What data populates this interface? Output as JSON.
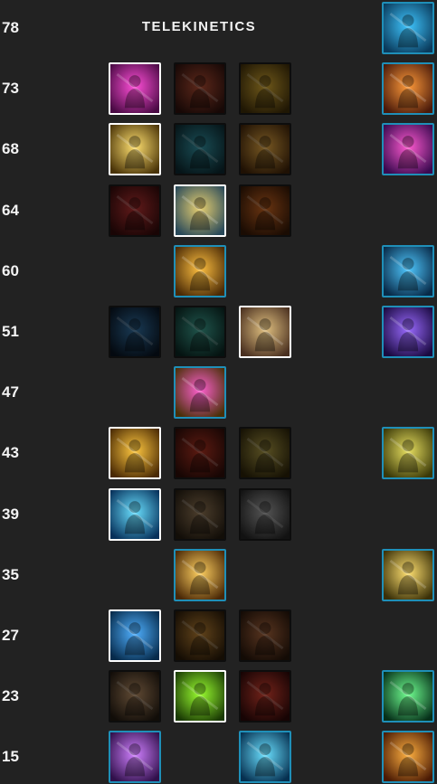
{
  "tree": {
    "title": "TELEKINETICS"
  },
  "rows": [
    {
      "level": "78",
      "slots": [
        {
          "col": 3,
          "state": "available",
          "icon": "telekinetic-hand-icon",
          "colors": [
            "#3fc6ff",
            "#0a3b5c"
          ]
        }
      ]
    },
    {
      "level": "73",
      "slots": [
        {
          "col": 0,
          "state": "selected",
          "icon": "pink-dash-icon",
          "colors": [
            "#ff4fd8",
            "#4a0a44"
          ]
        },
        {
          "col": 1,
          "state": "locked",
          "icon": "red-spin-icon",
          "colors": [
            "#a84830",
            "#2a100c"
          ]
        },
        {
          "col": 2,
          "state": "locked",
          "icon": "gold-figure-icon",
          "colors": [
            "#c9a030",
            "#3a2a08"
          ]
        },
        {
          "col": 3,
          "state": "available",
          "icon": "orange-blast-icon",
          "colors": [
            "#ff9a3a",
            "#4a1a0a"
          ]
        }
      ]
    },
    {
      "level": "68",
      "slots": [
        {
          "col": 0,
          "state": "selected",
          "icon": "golden-beam-icon",
          "colors": [
            "#ffe070",
            "#4a3408"
          ]
        },
        {
          "col": 1,
          "state": "locked",
          "icon": "teal-figure-icon",
          "colors": [
            "#2f8b9a",
            "#0c262c"
          ]
        },
        {
          "col": 2,
          "state": "locked",
          "icon": "golden-pyramid-icon",
          "colors": [
            "#d9a040",
            "#3a2008"
          ]
        },
        {
          "col": 3,
          "state": "available",
          "icon": "purple-storm-icon",
          "colors": [
            "#ff5ad0",
            "#3a0a50"
          ]
        }
      ]
    },
    {
      "level": "64",
      "slots": [
        {
          "col": 0,
          "state": "locked",
          "icon": "red-runner-icon",
          "colors": [
            "#b03030",
            "#2e0a0a"
          ]
        },
        {
          "col": 1,
          "state": "selected",
          "icon": "orbiting-stones-icon",
          "colors": [
            "#e8d070",
            "#2a4a5a"
          ]
        },
        {
          "col": 2,
          "state": "locked",
          "icon": "burning-figure-icon",
          "colors": [
            "#c06020",
            "#301606"
          ]
        }
      ]
    },
    {
      "level": "60",
      "slots": [
        {
          "col": 1,
          "state": "available",
          "icon": "golden-projectile-icon",
          "colors": [
            "#ffc040",
            "#4a2a06"
          ]
        },
        {
          "col": 3,
          "state": "available",
          "icon": "blue-fist-icon",
          "colors": [
            "#4fc8ff",
            "#082a48"
          ]
        }
      ]
    },
    {
      "level": "51",
      "slots": [
        {
          "col": 0,
          "state": "locked",
          "icon": "shadow-figure-icon",
          "colors": [
            "#2f6a9a",
            "#08121e"
          ]
        },
        {
          "col": 1,
          "state": "locked",
          "icon": "teal-sprint-icon",
          "colors": [
            "#3a9a8a",
            "#0a2420"
          ]
        },
        {
          "col": 2,
          "state": "selected",
          "icon": "robed-master-icon",
          "colors": [
            "#e0c080",
            "#4a3020"
          ]
        },
        {
          "col": 3,
          "state": "available",
          "icon": "purple-dome-icon",
          "colors": [
            "#9a6aff",
            "#1a0a40"
          ]
        }
      ]
    },
    {
      "level": "47",
      "slots": [
        {
          "col": 1,
          "state": "available",
          "icon": "pink-lightning-icon",
          "colors": [
            "#ff60d0",
            "#4a3008"
          ]
        }
      ]
    },
    {
      "level": "43",
      "slots": [
        {
          "col": 0,
          "state": "selected",
          "icon": "golden-aura-icon",
          "colors": [
            "#ffc840",
            "#4a2a04"
          ]
        },
        {
          "col": 1,
          "state": "locked",
          "icon": "red-crowd-icon",
          "colors": [
            "#a83020",
            "#2a0c08"
          ]
        },
        {
          "col": 2,
          "state": "locked",
          "icon": "olive-meditation-icon",
          "colors": [
            "#a09040",
            "#282008"
          ]
        },
        {
          "col": 3,
          "state": "available",
          "icon": "twin-heads-icon",
          "colors": [
            "#e8e060",
            "#3a3808"
          ]
        }
      ]
    },
    {
      "level": "39",
      "slots": [
        {
          "col": 0,
          "state": "selected",
          "icon": "blue-pillar-icon",
          "colors": [
            "#6ae0ff",
            "#06305a"
          ]
        },
        {
          "col": 1,
          "state": "locked",
          "icon": "faded-figure-icon",
          "colors": [
            "#8a7050",
            "#221a10"
          ]
        },
        {
          "col": 2,
          "state": "locked",
          "icon": "grey-wind-icon",
          "colors": [
            "#9a9a9a",
            "#222222"
          ]
        }
      ]
    },
    {
      "level": "35",
      "slots": [
        {
          "col": 1,
          "state": "available",
          "icon": "golden-burst-icon",
          "colors": [
            "#ffd060",
            "#4a2806"
          ]
        },
        {
          "col": 3,
          "state": "available",
          "icon": "raised-arms-icon",
          "colors": [
            "#ffe070",
            "#3a3008"
          ]
        }
      ]
    },
    {
      "level": "27",
      "slots": [
        {
          "col": 0,
          "state": "selected",
          "icon": "blue-palm-icon",
          "colors": [
            "#4fb0ff",
            "#062a4a"
          ]
        },
        {
          "col": 1,
          "state": "locked",
          "icon": "raised-fist-icon",
          "colors": [
            "#b07a30",
            "#261808"
          ]
        },
        {
          "col": 2,
          "state": "locked",
          "icon": "rubble-icon",
          "colors": [
            "#a0603a",
            "#24140a"
          ]
        }
      ]
    },
    {
      "level": "23",
      "slots": [
        {
          "col": 0,
          "state": "locked",
          "icon": "force-palm-icon",
          "colors": [
            "#b08860",
            "#201810"
          ]
        },
        {
          "col": 1,
          "state": "selected",
          "icon": "green-head-icon",
          "colors": [
            "#9aff30",
            "#1a3a04"
          ]
        },
        {
          "col": 2,
          "state": "locked",
          "icon": "red-beam-icon",
          "colors": [
            "#d04030",
            "#2a0808"
          ]
        },
        {
          "col": 3,
          "state": "available",
          "icon": "green-blade-icon",
          "colors": [
            "#70ff90",
            "#06301a"
          ]
        }
      ]
    },
    {
      "level": "15",
      "slots": [
        {
          "col": 0,
          "state": "available",
          "icon": "purple-shield-icon",
          "colors": [
            "#d080ff",
            "#30104a"
          ]
        },
        {
          "col": 2,
          "state": "available",
          "icon": "blue-fountain-icon",
          "colors": [
            "#6ae0ff",
            "#063050"
          ]
        },
        {
          "col": 3,
          "state": "available",
          "icon": "orange-hand-icon",
          "colors": [
            "#ffb040",
            "#4a1a04"
          ]
        }
      ]
    }
  ]
}
